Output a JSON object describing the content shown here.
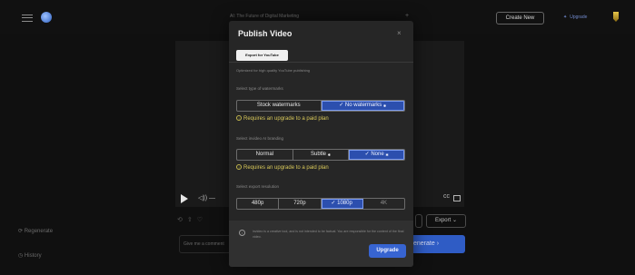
{
  "header": {
    "document_title": "AI: The Future of Digital Marketing",
    "plus_symbol": "+",
    "create_new_label": "Create New",
    "upgrade_label": "Upgrade"
  },
  "sidebar": {
    "regenerate_label": "Regenerate",
    "history_label": "History"
  },
  "background": {
    "comment_placeholder": "Give me a comment",
    "export_label": "Export",
    "export_chevron": "⌄",
    "regenerate_label": "enerate",
    "regenerate_chevron": "›"
  },
  "modal": {
    "title": "Publish Video",
    "close_symbol": "×",
    "tab_label": "Export for YouTube",
    "subtitle": "Optimized for high quality YouTube publishing",
    "watermarks": {
      "label": "Select type of watermarks",
      "options": [
        "Stock watermarks",
        "No watermarks"
      ],
      "selected": "No watermarks",
      "warning": "Requires an upgrade to a paid plan"
    },
    "branding": {
      "label": "Select invideo AI branding",
      "options": [
        "Normal",
        "Subtle",
        "None"
      ],
      "selected": "None",
      "warning": "Requires an upgrade to a paid plan"
    },
    "resolution": {
      "label": "Select export resolution",
      "options": [
        "480p",
        "720p",
        "1080p",
        "4K"
      ],
      "selected": "1080p"
    },
    "disclaimer": "invideo is a creative tool, and is not intended to be factual. You are responsible for the content of the final video.",
    "upgrade_button": "Upgrade",
    "check_mark": "✓",
    "paid_star": "✱"
  },
  "colors": {
    "accent": "#3764d1",
    "selected_segment": "#2c4fae",
    "warning": "#d9c95a"
  }
}
